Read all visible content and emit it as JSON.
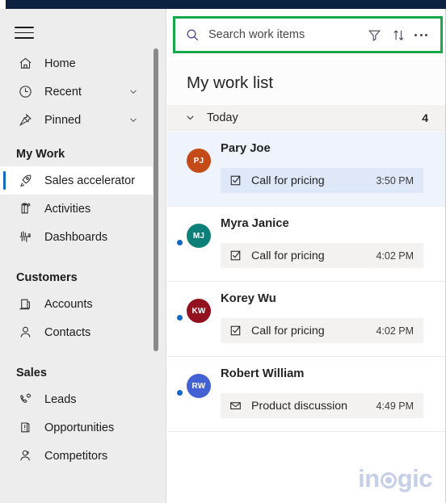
{
  "sidebar": {
    "menu_button": "menu-hamburger",
    "items": [
      {
        "label": "Home",
        "icon": "home-icon",
        "expandable": false,
        "selected": false
      },
      {
        "label": "Recent",
        "icon": "clock-icon",
        "expandable": true,
        "selected": false
      },
      {
        "label": "Pinned",
        "icon": "pin-icon",
        "expandable": true,
        "selected": false
      }
    ],
    "sections": [
      {
        "title": "My Work",
        "items": [
          {
            "label": "Sales accelerator",
            "icon": "rocket-icon",
            "selected": true
          },
          {
            "label": "Activities",
            "icon": "clipboard-icon",
            "selected": false
          },
          {
            "label": "Dashboards",
            "icon": "dashboard-icon",
            "selected": false
          }
        ]
      },
      {
        "title": "Customers",
        "items": [
          {
            "label": "Accounts",
            "icon": "building-icon",
            "selected": false
          },
          {
            "label": "Contacts",
            "icon": "person-icon",
            "selected": false
          }
        ]
      },
      {
        "title": "Sales",
        "items": [
          {
            "label": "Leads",
            "icon": "phone-gear-icon",
            "selected": false
          },
          {
            "label": "Opportunities",
            "icon": "opportunity-icon",
            "selected": false
          },
          {
            "label": "Competitors",
            "icon": "competitor-icon",
            "selected": false
          }
        ]
      }
    ]
  },
  "panel": {
    "search": {
      "placeholder": "Search work items",
      "value": "",
      "icon": "search-icon",
      "highlight_color": "#17a84a"
    },
    "header_actions": [
      {
        "name": "filter-icon",
        "label": "Filter"
      },
      {
        "name": "sort-icon",
        "label": "Sort"
      },
      {
        "name": "more-options-icon",
        "label": "More commands"
      }
    ],
    "title": "My work list",
    "group": {
      "label": "Today",
      "count": "4",
      "expanded": true
    },
    "cards": [
      {
        "name": "Pary Joe",
        "initials": "PJ",
        "avatar_color": "#c44a17",
        "unread": false,
        "selected": true,
        "task": {
          "icon": "checkbox-task-icon",
          "label": "Call for pricing",
          "time": "3:50 PM"
        }
      },
      {
        "name": "Myra Janice",
        "initials": "MJ",
        "avatar_color": "#0d7f79",
        "unread": true,
        "selected": false,
        "task": {
          "icon": "checkbox-task-icon",
          "label": "Call for pricing",
          "time": "4:02 PM"
        }
      },
      {
        "name": "Korey Wu",
        "initials": "KW",
        "avatar_color": "#93111f",
        "unread": true,
        "selected": false,
        "task": {
          "icon": "checkbox-task-icon",
          "label": "Call for pricing",
          "time": "4:02 PM"
        }
      },
      {
        "name": "Robert William",
        "initials": "RW",
        "unread": true,
        "avatar_color": "#4262d4",
        "selected": false,
        "task": {
          "icon": "envelope-task-icon",
          "label": "Product discussion",
          "time": "4:49 PM"
        }
      }
    ],
    "watermark": {
      "before": "in",
      "after": "gic"
    }
  }
}
